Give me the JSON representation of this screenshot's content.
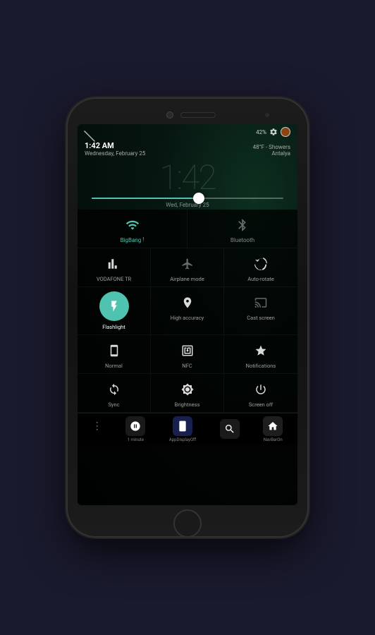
{
  "phone": {
    "status_bar": {
      "battery": "42%",
      "time_left": "",
      "settings_label": "settings"
    },
    "lock_screen": {
      "time": "1:42 AM",
      "date": "Wednesday, February 25",
      "weather": "48°F - Showers",
      "location": "Antalya",
      "big_time": "1:42",
      "small_date": "Wed, February 25"
    },
    "quick_settings": {
      "top_row": [
        {
          "id": "bigbang",
          "label": "BigBang",
          "icon": "wifi",
          "active": true
        },
        {
          "id": "bluetooth",
          "label": "Bluetooth",
          "icon": "bluetooth",
          "active": false
        }
      ],
      "grid": [
        {
          "id": "vodafone",
          "label": "VODAFONE TR",
          "icon": "signal",
          "active": false
        },
        {
          "id": "airplane",
          "label": "Airplane mode",
          "icon": "airplane",
          "active": false
        },
        {
          "id": "autorotate",
          "label": "Auto-rotate",
          "icon": "rotate",
          "active": false
        },
        {
          "id": "flashlight",
          "label": "Flashlight",
          "icon": "flashlight",
          "active": true
        },
        {
          "id": "accuracy",
          "label": "High accuracy",
          "icon": "location",
          "active": false
        },
        {
          "id": "castscreen",
          "label": "Cast screen",
          "icon": "cast",
          "active": false
        },
        {
          "id": "normal",
          "label": "Normal",
          "icon": "phone",
          "active": false
        },
        {
          "id": "nfc",
          "label": "NFC",
          "icon": "nfc",
          "active": false
        },
        {
          "id": "notifications",
          "label": "Notifications",
          "icon": "star",
          "active": false
        },
        {
          "id": "sync",
          "label": "Sync",
          "icon": "sync",
          "active": false
        },
        {
          "id": "brightness",
          "label": "Brightness",
          "icon": "brightness",
          "active": false
        },
        {
          "id": "screenoff",
          "label": "Screen off",
          "icon": "power",
          "active": false
        }
      ]
    },
    "dock": {
      "dots": "⋮",
      "items": [
        {
          "id": "app1",
          "icon": "📷",
          "label": "1 minute"
        },
        {
          "id": "app2",
          "icon": "📱",
          "label": "AppDisplayOff"
        },
        {
          "id": "app3",
          "icon": "🔍",
          "label": ""
        },
        {
          "id": "app4",
          "icon": "🏠",
          "label": "NavBarOn"
        }
      ]
    }
  }
}
